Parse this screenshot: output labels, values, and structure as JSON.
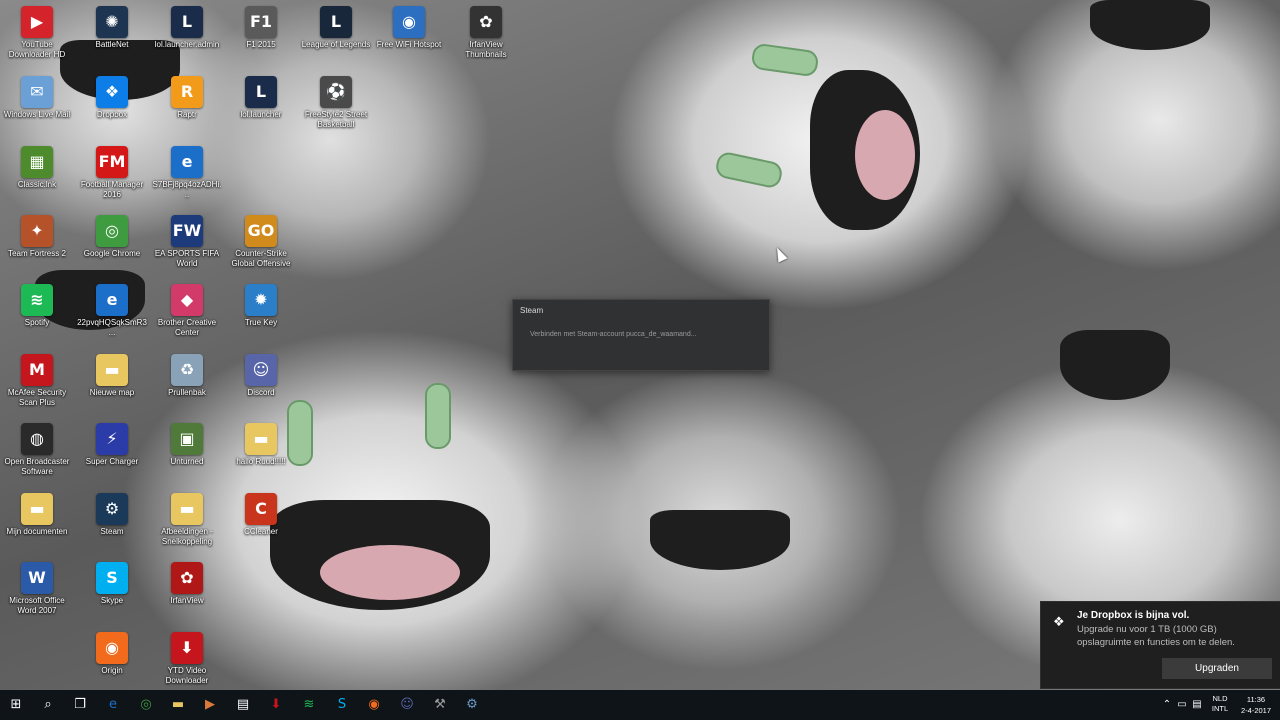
{
  "desktop_icons": [
    {
      "label": "YouTube Downloader HD",
      "glyph": "▶",
      "color": "#d4232b"
    },
    {
      "label": "BattleNet",
      "glyph": "✺",
      "color": "#1d3550"
    },
    {
      "label": "lol.launcher.admin",
      "glyph": "L",
      "color": "#1a2c4a"
    },
    {
      "label": "F1 2015",
      "glyph": "F1",
      "color": "#5a5a5a"
    },
    {
      "label": "League of Legends",
      "glyph": "L",
      "color": "#18283a"
    },
    {
      "label": "Free WiFi Hotspot",
      "glyph": "◉",
      "color": "#2c6fc0"
    },
    {
      "label": "IrfanView Thumbnails",
      "glyph": "✿",
      "color": "#333333"
    },
    {
      "label": "Windows Live Mail",
      "glyph": "✉",
      "color": "#6aa0d6"
    },
    {
      "label": "Dropbox",
      "glyph": "❖",
      "color": "#0d7ee8"
    },
    {
      "label": "Raptr",
      "glyph": "R",
      "color": "#f29a1a"
    },
    {
      "label": "lol.launcher",
      "glyph": "L",
      "color": "#1a2c4a"
    },
    {
      "label": "FreeStyle2 Street Basketball",
      "glyph": "⚽",
      "color": "#4a4a4a"
    },
    {
      "label": "Classic.lnk",
      "glyph": "▦",
      "color": "#4e8b2c"
    },
    {
      "label": "Football Manager 2016",
      "glyph": "FM",
      "color": "#d41818"
    },
    {
      "label": "S7BFj8pq4ozADHi...",
      "glyph": "e",
      "color": "#1c6fc9"
    },
    {
      "label": "Team Fortress 2",
      "glyph": "✦",
      "color": "#b5522a"
    },
    {
      "label": "Google Chrome",
      "glyph": "◎",
      "color": "#3f9b3f"
    },
    {
      "label": "EA SPORTS FIFA World",
      "glyph": "FW",
      "color": "#1d3a7a"
    },
    {
      "label": "Counter-Strike Global Offensive",
      "glyph": "GO",
      "color": "#d18a1c"
    },
    {
      "label": "Spotify",
      "glyph": "≋",
      "color": "#1db954"
    },
    {
      "label": "22pvqHQSqkSmR3...",
      "glyph": "e",
      "color": "#1c6fc9"
    },
    {
      "label": "Brother Creative Center",
      "glyph": "◆",
      "color": "#d23a6a"
    },
    {
      "label": "True Key",
      "glyph": "✹",
      "color": "#2b7fc8"
    },
    {
      "label": "McAfee Security Scan Plus",
      "glyph": "M",
      "color": "#c4161c"
    },
    {
      "label": "Nieuwe map",
      "glyph": "▬",
      "color": "#e8c660"
    },
    {
      "label": "Prullenbak",
      "glyph": "♻",
      "color": "#8aa2b8"
    },
    {
      "label": "Discord",
      "glyph": "☺",
      "color": "#5865a8"
    },
    {
      "label": "Open Broadcaster Software",
      "glyph": "◍",
      "color": "#2a2a2a"
    },
    {
      "label": "Super Charger",
      "glyph": "⚡",
      "color": "#2b3ca8"
    },
    {
      "label": "Unturned",
      "glyph": "▣",
      "color": "#4f7a3a"
    },
    {
      "label": "hallo Ruud!!!!!",
      "glyph": "▬",
      "color": "#e8c660"
    },
    {
      "label": "Mijn documenten",
      "glyph": "▬",
      "color": "#e8c660"
    },
    {
      "label": "Steam",
      "glyph": "⚙",
      "color": "#1b3a5a"
    },
    {
      "label": "Afbeeldingen - Snelkoppeling",
      "glyph": "▬",
      "color": "#e8c660"
    },
    {
      "label": "CCleaner",
      "glyph": "C",
      "color": "#c8341c"
    },
    {
      "label": "Microsoft Office Word 2007",
      "glyph": "W",
      "color": "#2b5aa8"
    },
    {
      "label": "Skype",
      "glyph": "S",
      "color": "#00aff0"
    },
    {
      "label": "IrfanView",
      "glyph": "✿",
      "color": "#b01818"
    },
    {
      "label": "Origin",
      "glyph": "◉",
      "color": "#f26a1c"
    },
    {
      "label": "YTD Video Downloader",
      "glyph": "⬇",
      "color": "#c4161c"
    }
  ],
  "steam_dialog": {
    "title": "Steam",
    "message": "Verbinden met Steam-account pucca_de_waamand..."
  },
  "dropbox_toast": {
    "icon": "dropbox-icon",
    "title": "Je Dropbox is bijna vol.",
    "body": "Upgrade nu voor 1 TB (1000 GB) opslagruimte en functies om te delen.",
    "button": "Upgraden"
  },
  "taskbar": {
    "items": [
      {
        "name": "start-button",
        "glyph": "⊞"
      },
      {
        "name": "search-icon",
        "glyph": "⌕"
      },
      {
        "name": "task-view-icon",
        "glyph": "❐"
      },
      {
        "name": "edge-icon",
        "glyph": "e",
        "color": "#1c6fc9"
      },
      {
        "name": "chrome-icon",
        "glyph": "◎",
        "color": "#3f9b3f"
      },
      {
        "name": "file-explorer-icon",
        "glyph": "▬",
        "color": "#e8c660"
      },
      {
        "name": "media-player-icon",
        "glyph": "▶",
        "color": "#d97a3a"
      },
      {
        "name": "store-icon",
        "glyph": "▤",
        "color": "#ffffff"
      },
      {
        "name": "ytd-icon",
        "glyph": "⬇",
        "color": "#c4161c"
      },
      {
        "name": "spotify-icon",
        "glyph": "≋",
        "color": "#1db954"
      },
      {
        "name": "skype-icon",
        "glyph": "S",
        "color": "#00aff0"
      },
      {
        "name": "origin-icon",
        "glyph": "◉",
        "color": "#f26a1c"
      },
      {
        "name": "discord-icon",
        "glyph": "☺",
        "color": "#5865a8"
      },
      {
        "name": "tool-icon",
        "glyph": "⚒",
        "color": "#9a9a9a"
      },
      {
        "name": "steam-icon",
        "glyph": "⚙",
        "color": "#6a9ac8"
      }
    ],
    "language_top": "NLD",
    "language_bottom": "INTL",
    "time": "11:36",
    "date": "2-4-2017"
  }
}
